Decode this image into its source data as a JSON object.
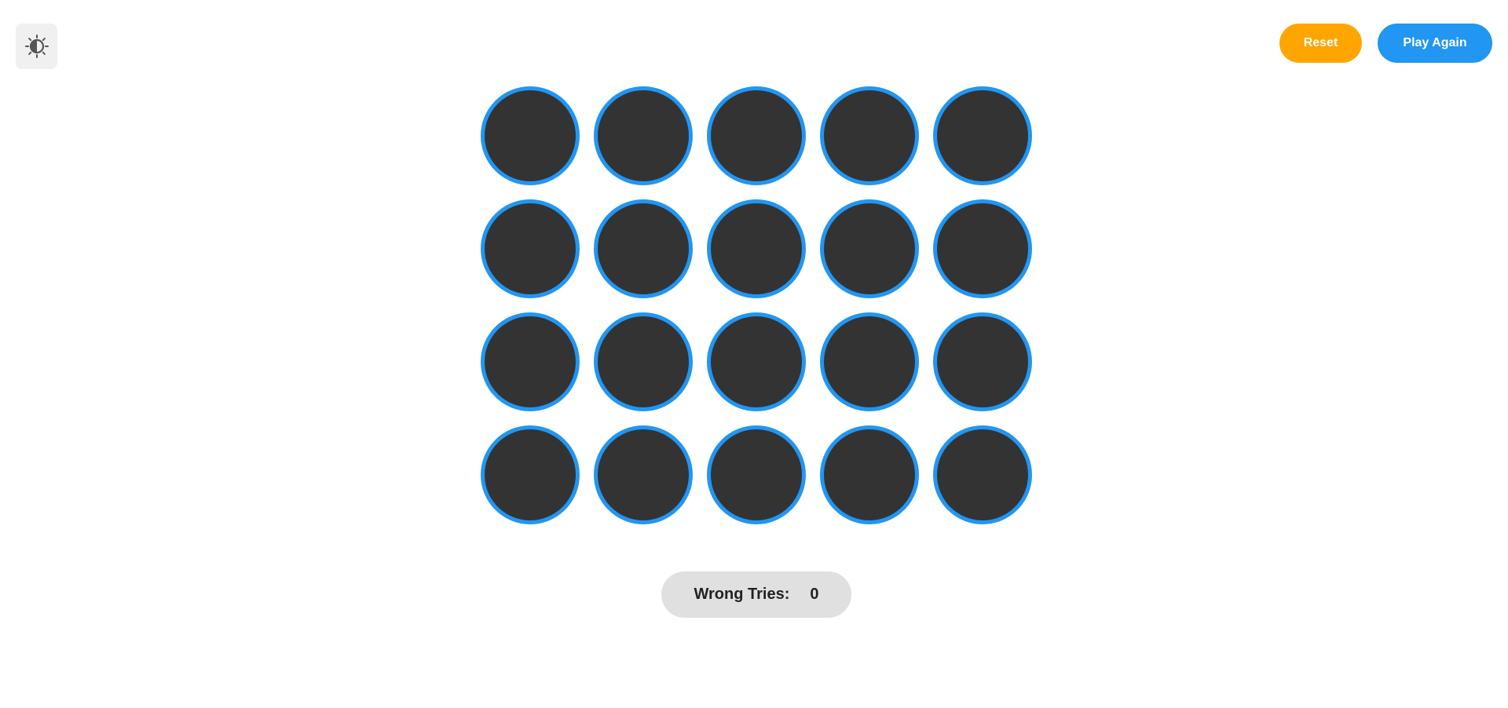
{
  "theme_toggle": {
    "icon": "contrast-sun-icon"
  },
  "toolbar": {
    "reset_label": "Reset",
    "play_again_label": "Play Again"
  },
  "board": {
    "rows": 4,
    "columns": 5,
    "circle_fill": "#333333",
    "circle_border": "#2196f3"
  },
  "status": {
    "wrong_tries_label": "Wrong Tries:",
    "wrong_tries_value": "0"
  },
  "colors": {
    "reset": "#ffa500",
    "play_again": "#2196f3",
    "background": "#ffffff"
  }
}
